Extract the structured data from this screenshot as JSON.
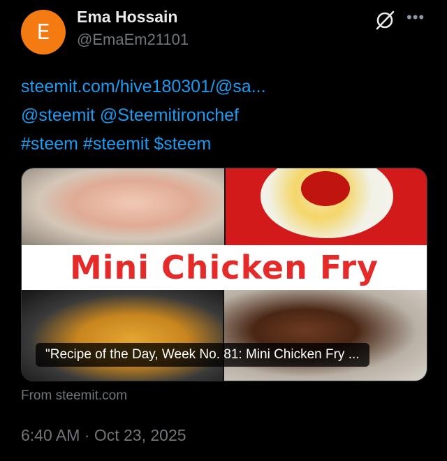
{
  "author": {
    "avatar_letter": "E",
    "avatar_color": "#f47b12",
    "name": "Ema Hossain",
    "handle": "@EmaEm21101"
  },
  "post": {
    "lines": [
      "steemit.com/hive180301/@sa...",
      "@steemit @Steemitironchef",
      "#steem #steemit $steem"
    ],
    "link_color": "#1d9bf0"
  },
  "card": {
    "image_title": "Mini Chicken Fry",
    "caption": "\"Recipe of the Day, Week No. 81: Mini Chicken Fry ...",
    "source": "From steemit.com"
  },
  "timestamp": "6:40 AM · Oct 23, 2025",
  "icons": [
    "grok-icon",
    "more-icon"
  ]
}
